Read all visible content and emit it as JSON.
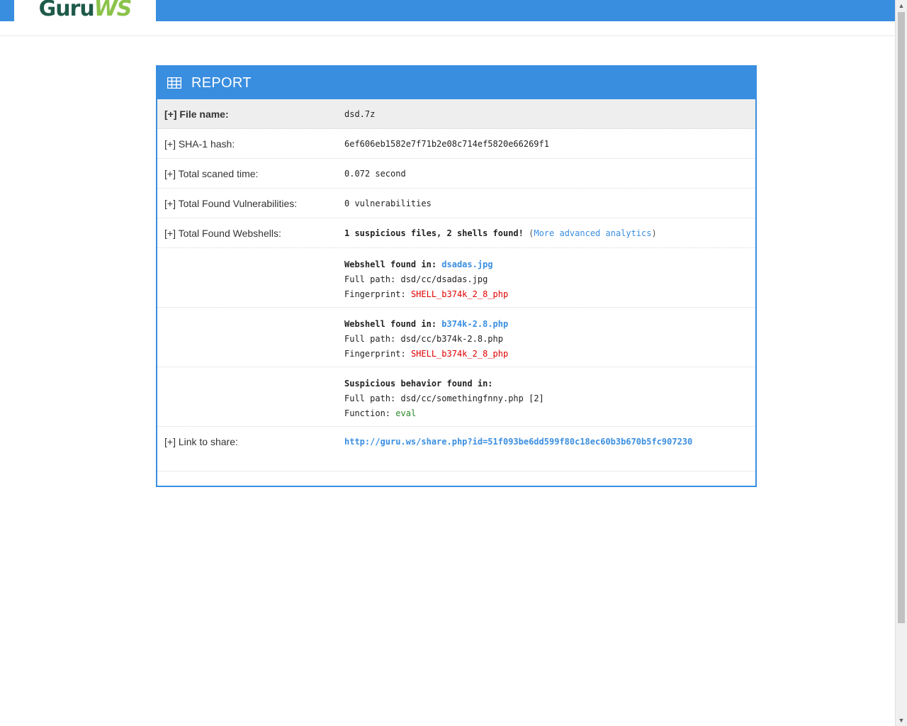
{
  "brand": {
    "logo_main": "Guru",
    "logo_accent": "WS"
  },
  "report": {
    "title": "REPORT",
    "file_name": {
      "label": "[+] File name:",
      "value": "dsd.7z"
    },
    "sha1": {
      "label": "[+] SHA-1 hash:",
      "value": "6ef606eb1582e7f71b2e08c714ef5820e66269f1"
    },
    "scan_time": {
      "label": "[+] Total scaned time:",
      "value": "0.072 second"
    },
    "vulnerabilities": {
      "label": "[+] Total Found Vulnerabilities:",
      "value": "0 vulnerabilities"
    },
    "webshells": {
      "label": "[+] Total Found Webshells:",
      "summary": "1 suspicious files, 2 shells found!",
      "paren_open": "(",
      "analytics_link": "More advanced analytics",
      "paren_close": ")"
    },
    "findings": [
      {
        "heading": "Webshell found in:",
        "file": "dsadas.jpg",
        "path_label": "Full path:",
        "path": "dsd/cc/dsadas.jpg",
        "fp_label": "Fingerprint:",
        "fingerprint": "SHELL_b374k_2_8_php"
      },
      {
        "heading": "Webshell found in:",
        "file": "b374k-2.8.php",
        "path_label": "Full path:",
        "path": "dsd/cc/b374k-2.8.php",
        "fp_label": "Fingerprint:",
        "fingerprint": "SHELL_b374k_2_8_php"
      }
    ],
    "suspicious": {
      "heading": "Suspicious behavior found in:",
      "path_label": "Full path:",
      "path": "dsd/cc/somethingfnny.php",
      "count": "[2]",
      "func_label": "Function:",
      "function": "eval"
    },
    "share": {
      "label": "[+] Link to share:",
      "url": "http://guru.ws/share.php?id=51f093be6dd599f80c18ec60b3b670b5fc907230"
    }
  }
}
